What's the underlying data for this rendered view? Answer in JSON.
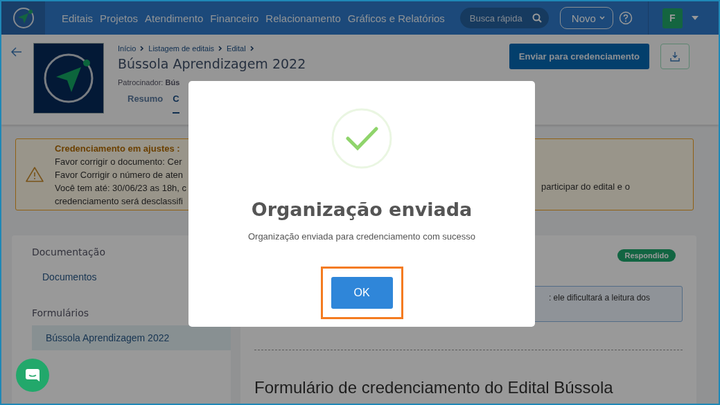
{
  "nav": {
    "items": [
      "Editais",
      "Projetos",
      "Atendimento",
      "Financeiro",
      "Relacionamento",
      "Gráficos e Relatórios"
    ],
    "search": {
      "placeholder": "Busca rápida"
    },
    "new_button": "Novo",
    "avatar": "F"
  },
  "header": {
    "breadcrumb": [
      "Início",
      "Listagem de editais",
      "Edital"
    ],
    "title": "Bússola Aprendizagem 2022",
    "sponsor_label": "Patrocinador:",
    "sponsor_value": "Bús",
    "tabs": [
      {
        "label": "Resumo",
        "selected": false
      },
      {
        "label": "C",
        "selected": true
      }
    ],
    "send_button": "Enviar para credenciamento"
  },
  "alert": {
    "title": "Credenciamento em ajustes :",
    "lines": [
      "Favor corrigir o documento: Cer",
      "Favor Corrigir o número de aten",
      "Você tem até: 30/06/23 as 18h, c",
      "credenciamento será desclassifi"
    ],
    "right_fragment": "participar do edital e o"
  },
  "sidebar": {
    "groups": [
      {
        "title": "Documentação",
        "items": [
          {
            "label": "Documentos",
            "selected": false
          }
        ]
      },
      {
        "title": "Formulários",
        "items": [
          {
            "label": "Bússola Aprendizagem 2022",
            "selected": true
          }
        ]
      }
    ]
  },
  "content": {
    "badge": "Respondido",
    "info_fragment": ": ele dificultará a leitura dos",
    "heading": "Formulário de credenciamento do Edital Bússola"
  },
  "modal": {
    "title": "Organização enviada",
    "message": "Organização enviada para credenciamento com sucesso",
    "button": "OK",
    "button_highlighted": true
  }
}
